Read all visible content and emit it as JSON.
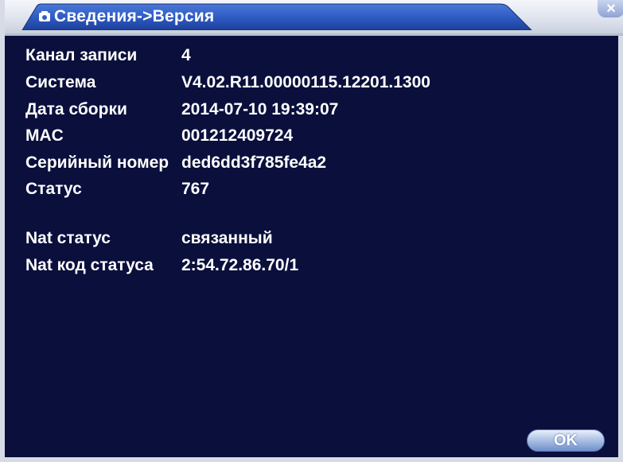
{
  "window": {
    "title": "Сведения->Версия",
    "close_symbol": "×"
  },
  "info": {
    "rows": [
      {
        "label": "Канал записи",
        "value": "4"
      },
      {
        "label": "Система",
        "value": "V4.02.R11.00000115.12201.1300"
      },
      {
        "label": "Дата сборки",
        "value": "2014-07-10 19:39:07"
      },
      {
        "label": "MAC",
        "value": "001212409724"
      },
      {
        "label": "Серийный номер",
        "value": "ded6dd3f785fe4a2"
      },
      {
        "label": "Статус",
        "value": "767"
      }
    ],
    "nat_rows": [
      {
        "label": "Nat статус",
        "value": "связанный"
      },
      {
        "label": "Nat код статуса",
        "value": "2:54.72.86.70/1"
      }
    ]
  },
  "buttons": {
    "ok_label": "OK"
  },
  "colors": {
    "background": "#0a0f3c",
    "title_tab": "#2f5cc4",
    "text": "#ffffff"
  }
}
